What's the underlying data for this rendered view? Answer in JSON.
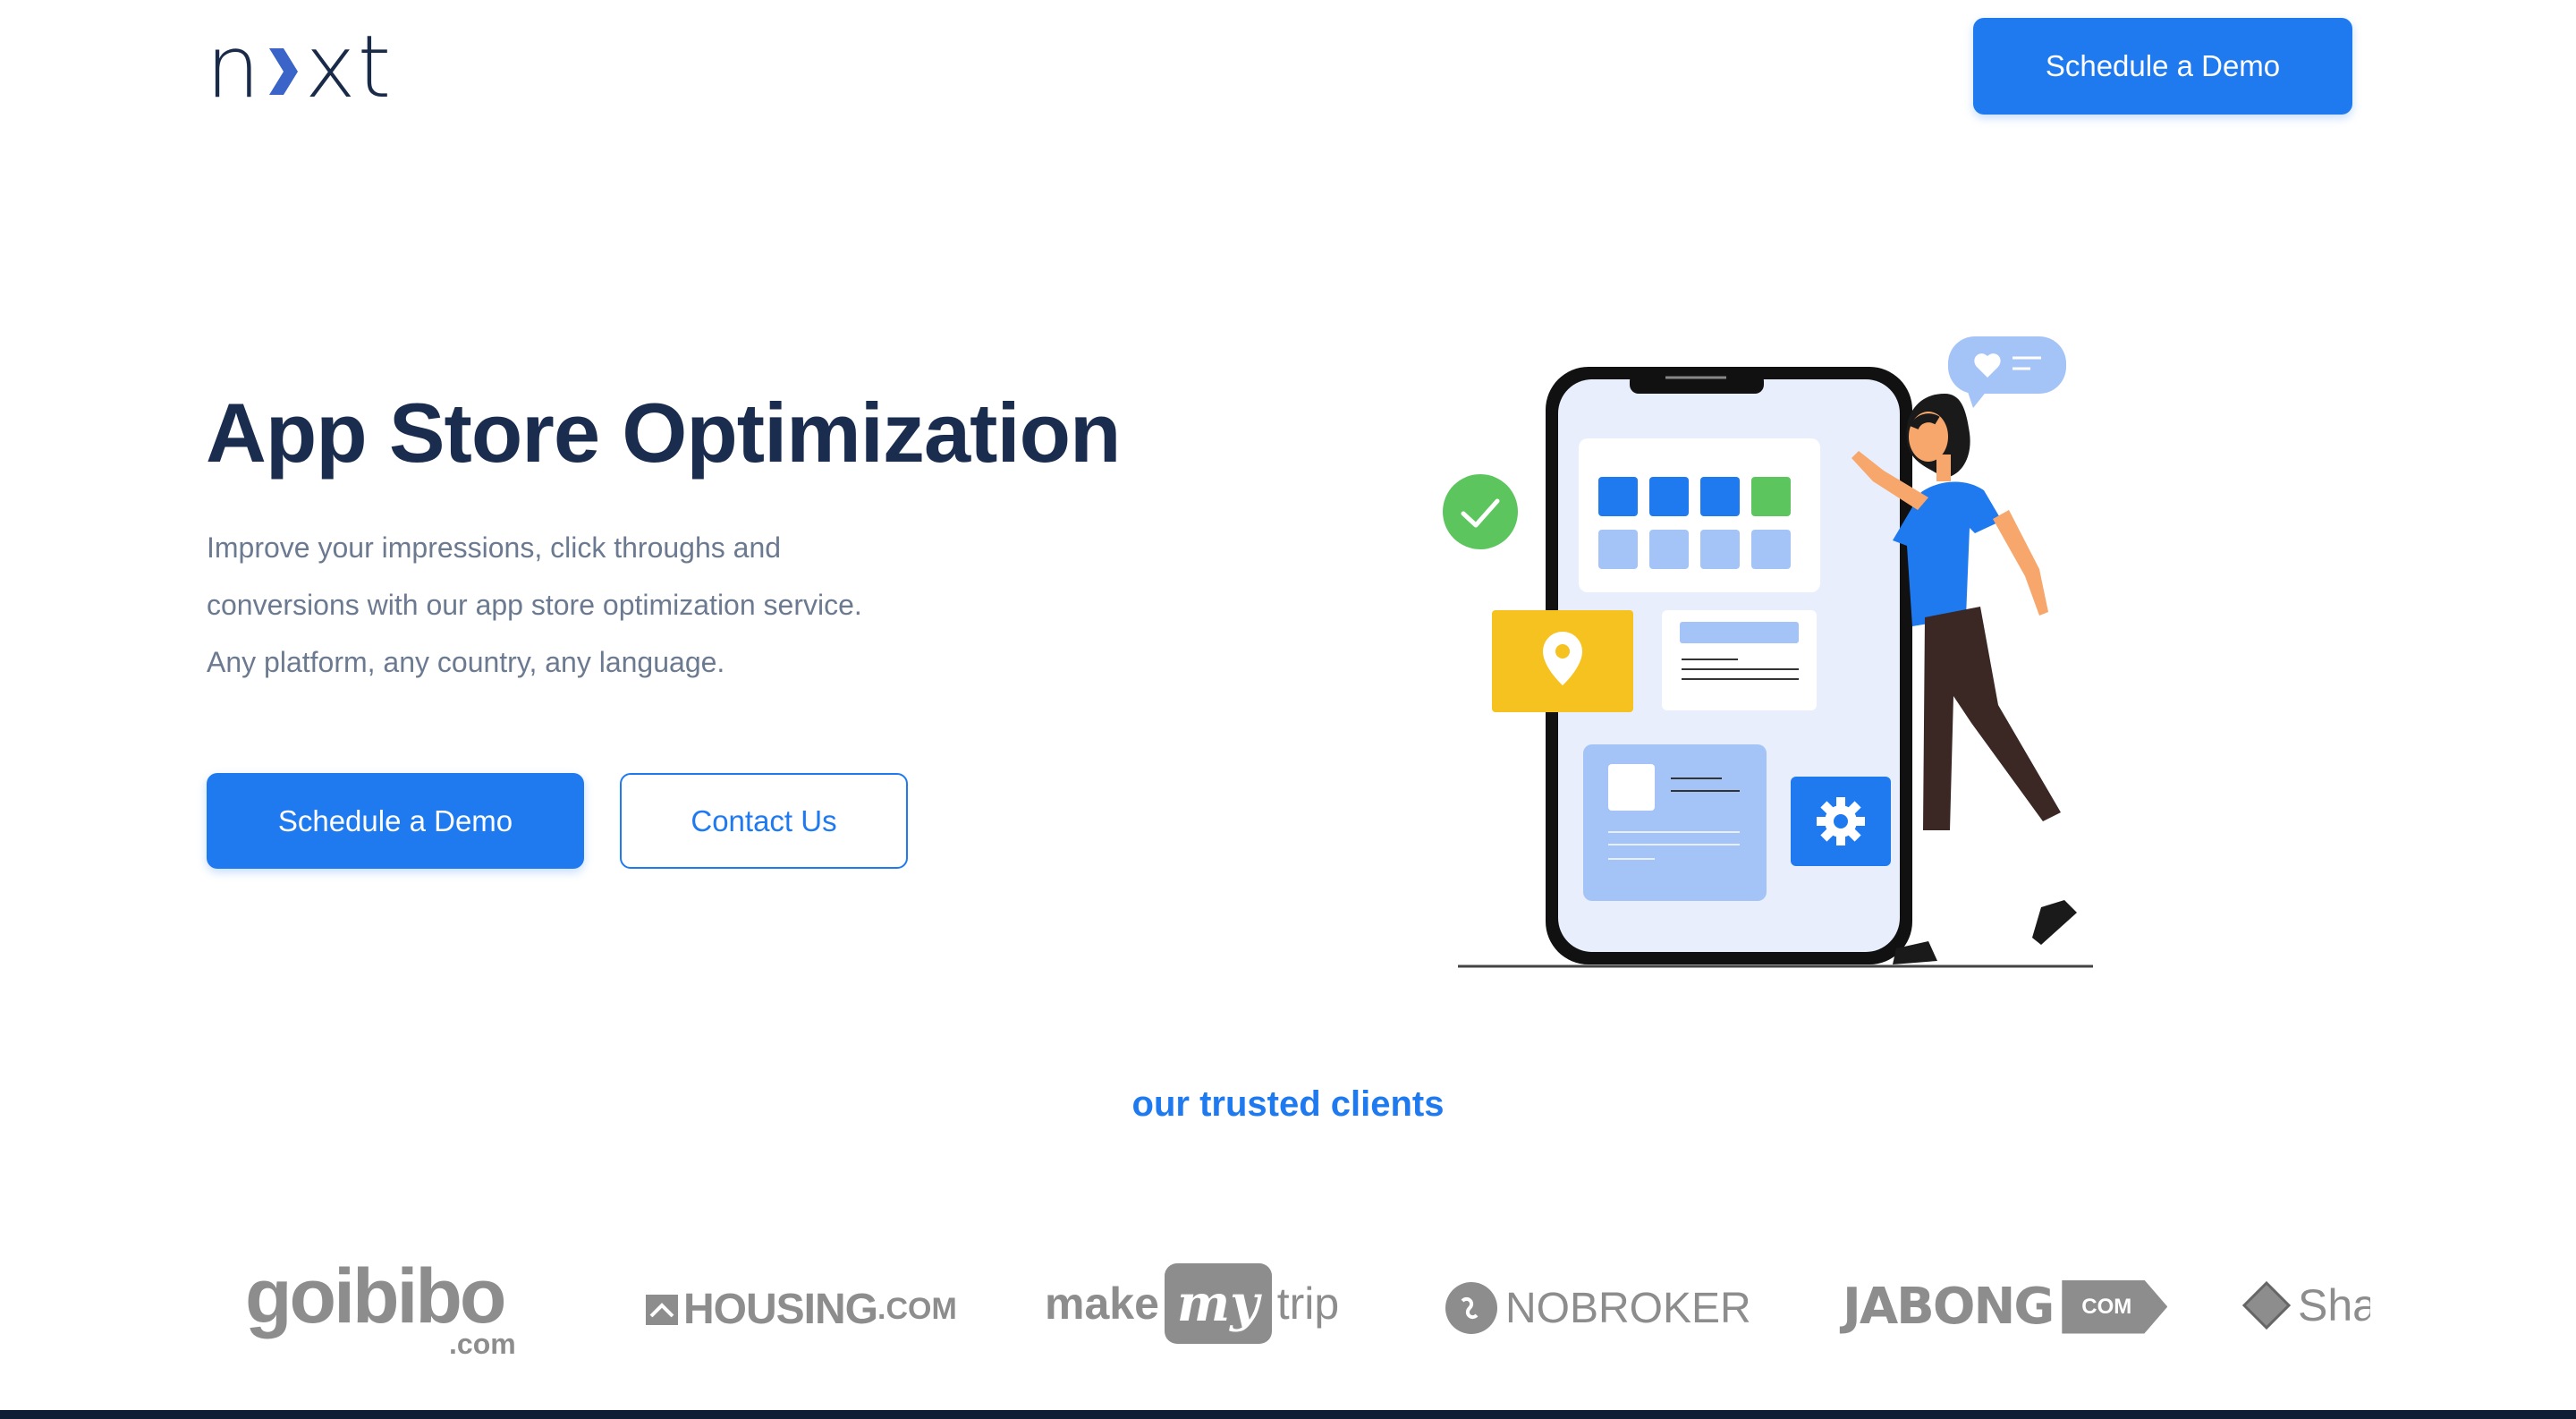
{
  "header": {
    "logo_text_left": "n",
    "logo_text_right": "xt",
    "cta_label": "Schedule a Demo"
  },
  "hero": {
    "title": "App Store Optimization",
    "description_lines": [
      "Improve your impressions, click throughs and",
      "conversions with our app store optimization service.",
      "Any platform, any country, any language."
    ],
    "primary_button": "Schedule a Demo",
    "secondary_button": "Contact Us"
  },
  "clients": {
    "title": "our trusted clients",
    "logos": [
      {
        "name": "goibibo",
        "suffix": ".com"
      },
      {
        "name": "HOUSING",
        "suffix": ".COM"
      },
      {
        "name_left": "make",
        "name_mid": "my",
        "name_right": "trip"
      },
      {
        "name": "NOBROKER"
      },
      {
        "name": "JABONG",
        "suffix": "COM"
      },
      {
        "name": "Sha"
      }
    ]
  },
  "colors": {
    "accent": "#1f7af0",
    "heading": "#1b2d4f",
    "body_text": "#6b7a90",
    "logo_gray": "#8d8d8d"
  },
  "icons": [
    "chevron-right-icon",
    "check-icon",
    "location-pin-icon",
    "gear-icon",
    "heart-icon",
    "house-icon"
  ]
}
